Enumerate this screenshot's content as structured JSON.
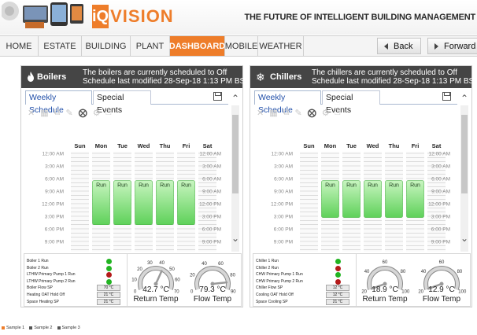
{
  "header": {
    "logo_iq": "iQ",
    "logo_vision": "VISION",
    "tagline": "THE FUTURE OF INTELLIGENT BUILDING MANAGEMENT"
  },
  "nav": {
    "items": [
      {
        "label": "HOME",
        "active": false
      },
      {
        "label": "ESTATE",
        "active": false
      },
      {
        "label": "BUILDING",
        "active": false
      },
      {
        "label": "PLANT",
        "active": false
      },
      {
        "label": "DASHBOARD",
        "active": true
      },
      {
        "label": "MOBILE",
        "active": false
      },
      {
        "label": "WEATHER",
        "active": false
      }
    ],
    "back": "Back",
    "forward": "Forward"
  },
  "schedule": {
    "days": [
      "Sun",
      "Mon",
      "Tue",
      "Wed",
      "Thu",
      "Fri",
      "Sat"
    ],
    "times": [
      "12:00 AM",
      "3:00 AM",
      "6:00 AM",
      "9:00 AM",
      "12:00 PM",
      "3:00 PM",
      "6:00 PM",
      "9:00 PM"
    ],
    "run_label": "Run"
  },
  "colors": {
    "accent": "#ee7d2a",
    "panel_header": "#454545",
    "run_top": "#c8f5c0",
    "run_bottom": "#5fd15a",
    "status_on": "#22b422",
    "status_off": "#b41a1a"
  },
  "panels": [
    {
      "title": "Boilers",
      "icon": "flame-icon",
      "status_line1": "The boilers are currently scheduled to Off",
      "status_line2": "Schedule last modified 28-Sep-18 1:13 PM BST",
      "tab1": "Weekly Schedule",
      "tab2": "Special Events",
      "run_days": [
        1,
        2,
        3,
        4,
        5
      ],
      "run_start_hour": 6.5,
      "run_end_hour": 17,
      "status_rows": [
        {
          "label": "Boiler 1 Run",
          "type": "dot",
          "state": "on"
        },
        {
          "label": "Boiler 2 Run",
          "type": "dot",
          "state": "on"
        },
        {
          "label": "LTHW Primary Pump 1 Run",
          "type": "dot",
          "state": "off"
        },
        {
          "label": "LTHW Primary Pump 2 Run",
          "type": "dot",
          "state": "on"
        },
        {
          "label": "Boiler Flow SP",
          "type": "value",
          "value": "70 °C"
        },
        {
          "label": "Heating OAT Hold Off",
          "type": "value",
          "value": "21 °C"
        },
        {
          "label": "Space Heating SP",
          "type": "value",
          "value": "21 °C"
        }
      ],
      "gauges": [
        {
          "label": "Return Temp",
          "value": 42.7,
          "unit": "°C",
          "min": 0,
          "max": 70,
          "ticks": [
            10,
            20,
            30,
            40,
            50,
            60,
            70
          ]
        },
        {
          "label": "Flow Temp",
          "value": 79.3,
          "unit": "°C",
          "min": 0,
          "max": 90,
          "ticks": [
            0,
            20,
            40,
            60,
            80,
            90
          ]
        }
      ],
      "gauge_ticks_shown": [
        {
          "gauge": 0,
          "labels": [
            "0",
            "10",
            "20",
            "30",
            "40",
            "50",
            "60",
            "70"
          ]
        },
        {
          "gauge": 1,
          "labels": [
            "0",
            "20",
            "40",
            "60",
            "80",
            "90"
          ]
        }
      ]
    },
    {
      "title": "Chillers",
      "icon": "snowflake-icon",
      "status_line1": "The chillers are currently scheduled to Off",
      "status_line2": "Schedule last modified 28-Sep-18 1:13 PM BST",
      "tab1": "Weekly Schedule",
      "tab2": "Special Events",
      "run_days": [
        1,
        2,
        3,
        4,
        5
      ],
      "run_start_hour": 6.5,
      "run_end_hour": 15.3,
      "status_rows": [
        {
          "label": "Chiller 1 Run",
          "type": "dot",
          "state": "on"
        },
        {
          "label": "Chiller 2 Run",
          "type": "dot",
          "state": "off"
        },
        {
          "label": "CHW Primary Pump 1 Run",
          "type": "dot",
          "state": "on"
        },
        {
          "label": "CHW Primary Pump 2 Run",
          "type": "dot",
          "state": "off"
        },
        {
          "label": "Chiller Flow SP",
          "type": "value",
          "value": "12 °C"
        },
        {
          "label": "Cooling OAT Hold Off",
          "type": "value",
          "value": "12 °C"
        },
        {
          "label": "Space Cooling SP",
          "type": "value",
          "value": "21 °C"
        }
      ],
      "gauges": [
        {
          "label": "Return Temp",
          "value": 18.9,
          "unit": "°C",
          "min": 20,
          "max": 100
        },
        {
          "label": "Flow Temp",
          "value": 12.9,
          "unit": "°C",
          "min": 20,
          "max": 100
        }
      ],
      "gauge_ticks_shown": [
        {
          "gauge": 0,
          "labels": [
            "20",
            "40",
            "60",
            "80",
            "100"
          ]
        },
        {
          "gauge": 1,
          "labels": [
            "20",
            "40",
            "60",
            "80",
            "100"
          ]
        }
      ]
    }
  ],
  "legend": [
    {
      "label": "Sample 1",
      "color": "#ee7d2a"
    },
    {
      "label": "Sample 2",
      "color": "#555555"
    },
    {
      "label": "Sample 3",
      "color": "#555555"
    }
  ]
}
